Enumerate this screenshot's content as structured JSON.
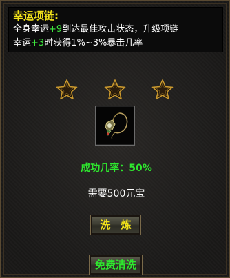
{
  "description": {
    "title": "幸运项链:",
    "line1": {
      "pre": "全身幸运",
      "value": "+9",
      "post": "到达最佳攻击状态，升级项链"
    },
    "line2": {
      "pre": "幸运",
      "value": "+3",
      "post": "时获得1%~3%暴击几率"
    }
  },
  "stars": {
    "count": 3,
    "filled": 0,
    "icon": "star-icon"
  },
  "item": {
    "icon": "necklace-icon"
  },
  "success_rate": "成功几率：50%",
  "cost": "需要500元宝",
  "buttons": {
    "wash_label": "洗 炼",
    "free_clean_label": "免费清洗"
  },
  "colors": {
    "title": "#f2e21a",
    "highlight": "#3ee83e",
    "success": "#2ee82e",
    "text": "#ffffff"
  }
}
